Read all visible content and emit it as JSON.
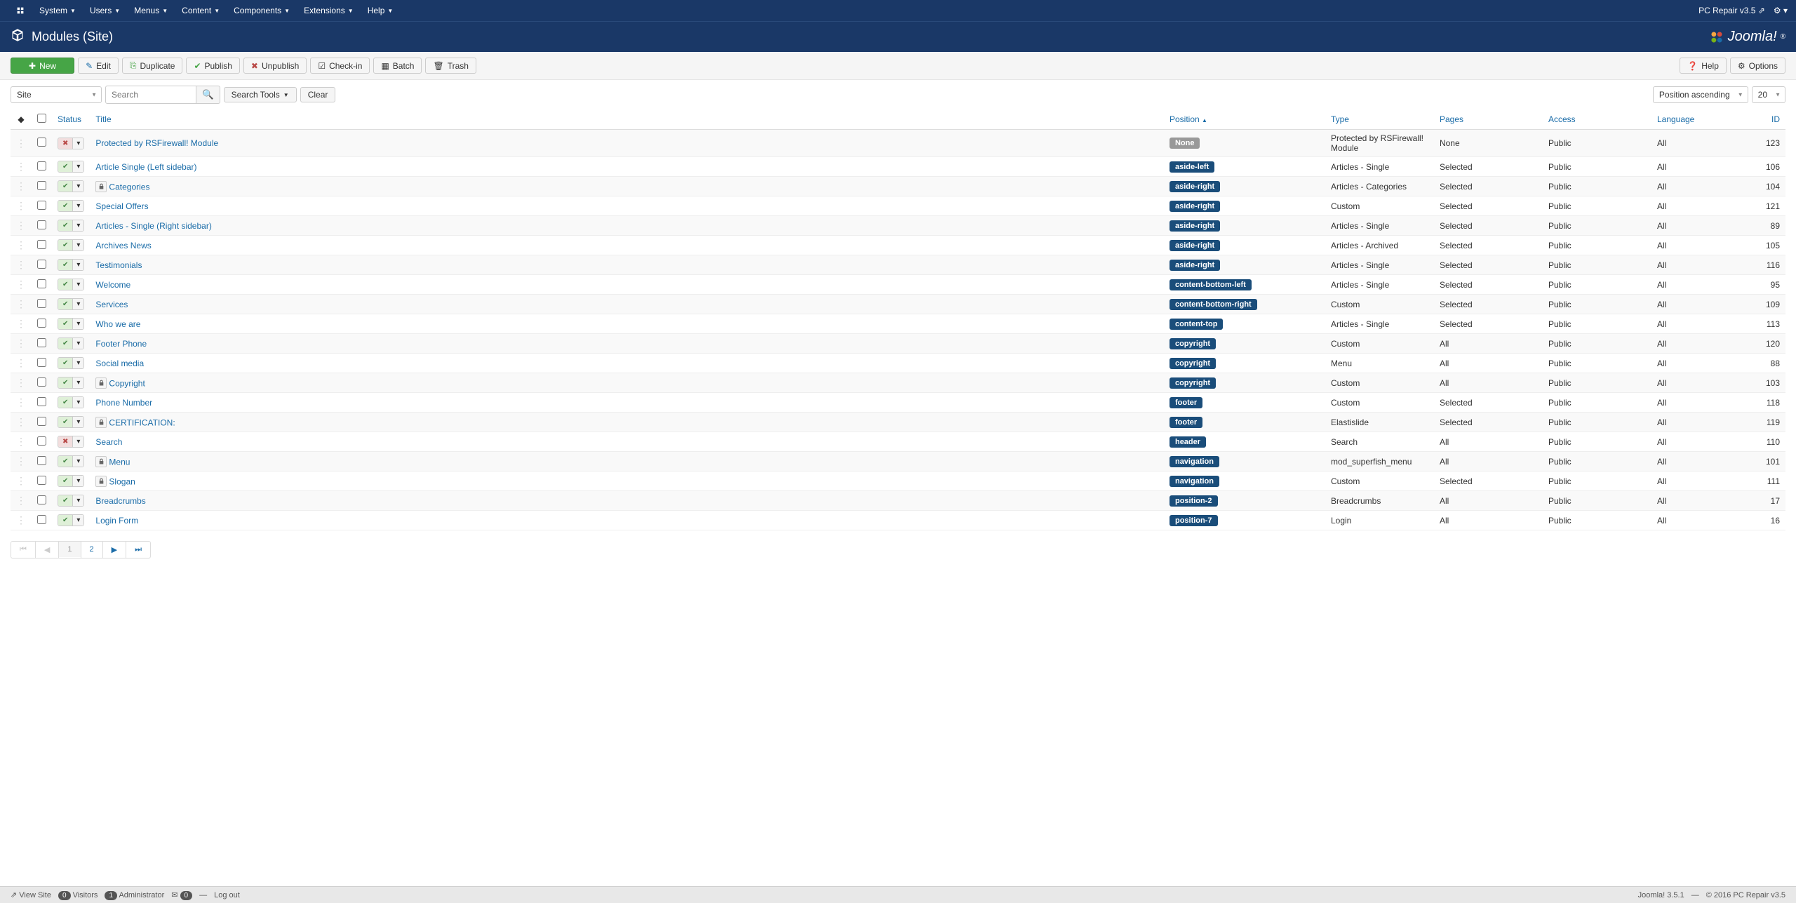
{
  "topnav": {
    "items": [
      "System",
      "Users",
      "Menus",
      "Content",
      "Components",
      "Extensions",
      "Help"
    ],
    "site_name": "PC Repair v3.5"
  },
  "header": {
    "title": "Modules (Site)",
    "brand": "Joomla!"
  },
  "toolbar": {
    "new": "New",
    "edit": "Edit",
    "duplicate": "Duplicate",
    "publish": "Publish",
    "unpublish": "Unpublish",
    "checkin": "Check-in",
    "batch": "Batch",
    "trash": "Trash",
    "help": "Help",
    "options": "Options"
  },
  "filter": {
    "client": "Site",
    "search_placeholder": "Search",
    "search_tools": "Search Tools",
    "clear": "Clear",
    "sort": "Position ascending",
    "limit": "20"
  },
  "columns": {
    "status": "Status",
    "title": "Title",
    "position": "Position",
    "type": "Type",
    "pages": "Pages",
    "access": "Access",
    "language": "Language",
    "id": "ID"
  },
  "rows": [
    {
      "published": false,
      "locked": false,
      "title": "Protected by RSFirewall! Module",
      "position": "None",
      "pos_none": true,
      "type": "Protected by RSFirewall! Module",
      "pages": "None",
      "access": "Public",
      "lang": "All",
      "id": "123"
    },
    {
      "published": true,
      "locked": false,
      "title": "Article Single (Left sidebar)",
      "position": "aside-left",
      "type": "Articles - Single",
      "pages": "Selected",
      "access": "Public",
      "lang": "All",
      "id": "106"
    },
    {
      "published": true,
      "locked": true,
      "title": "Categories",
      "position": "aside-right",
      "type": "Articles - Categories",
      "pages": "Selected",
      "access": "Public",
      "lang": "All",
      "id": "104"
    },
    {
      "published": true,
      "locked": false,
      "title": "Special Offers",
      "position": "aside-right",
      "type": "Custom",
      "pages": "Selected",
      "access": "Public",
      "lang": "All",
      "id": "121"
    },
    {
      "published": true,
      "locked": false,
      "title": "Articles - Single (Right sidebar)",
      "position": "aside-right",
      "type": "Articles - Single",
      "pages": "Selected",
      "access": "Public",
      "lang": "All",
      "id": "89"
    },
    {
      "published": true,
      "locked": false,
      "title": "Archives News",
      "position": "aside-right",
      "type": "Articles - Archived",
      "pages": "Selected",
      "access": "Public",
      "lang": "All",
      "id": "105"
    },
    {
      "published": true,
      "locked": false,
      "title": "Testimonials",
      "position": "aside-right",
      "type": "Articles - Single",
      "pages": "Selected",
      "access": "Public",
      "lang": "All",
      "id": "116"
    },
    {
      "published": true,
      "locked": false,
      "title": "Welcome",
      "position": "content-bottom-left",
      "type": "Articles - Single",
      "pages": "Selected",
      "access": "Public",
      "lang": "All",
      "id": "95"
    },
    {
      "published": true,
      "locked": false,
      "title": "Services",
      "position": "content-bottom-right",
      "type": "Custom",
      "pages": "Selected",
      "access": "Public",
      "lang": "All",
      "id": "109"
    },
    {
      "published": true,
      "locked": false,
      "title": "Who we are",
      "position": "content-top",
      "type": "Articles - Single",
      "pages": "Selected",
      "access": "Public",
      "lang": "All",
      "id": "113"
    },
    {
      "published": true,
      "locked": false,
      "title": "Footer Phone",
      "position": "copyright",
      "type": "Custom",
      "pages": "All",
      "access": "Public",
      "lang": "All",
      "id": "120"
    },
    {
      "published": true,
      "locked": false,
      "title": "Social media",
      "position": "copyright",
      "type": "Menu",
      "pages": "All",
      "access": "Public",
      "lang": "All",
      "id": "88"
    },
    {
      "published": true,
      "locked": true,
      "title": "Copyright",
      "position": "copyright",
      "type": "Custom",
      "pages": "All",
      "access": "Public",
      "lang": "All",
      "id": "103"
    },
    {
      "published": true,
      "locked": false,
      "title": "Phone Number",
      "position": "footer",
      "type": "Custom",
      "pages": "Selected",
      "access": "Public",
      "lang": "All",
      "id": "118"
    },
    {
      "published": true,
      "locked": true,
      "title": "CERTIFICATION:",
      "position": "footer",
      "type": "Elastislide",
      "pages": "Selected",
      "access": "Public",
      "lang": "All",
      "id": "119"
    },
    {
      "published": false,
      "locked": false,
      "title": "Search",
      "position": "header",
      "type": "Search",
      "pages": "All",
      "access": "Public",
      "lang": "All",
      "id": "110"
    },
    {
      "published": true,
      "locked": true,
      "title": "Menu",
      "position": "navigation",
      "type": "mod_superfish_menu",
      "pages": "All",
      "access": "Public",
      "lang": "All",
      "id": "101"
    },
    {
      "published": true,
      "locked": true,
      "title": "Slogan",
      "position": "navigation",
      "type": "Custom",
      "pages": "Selected",
      "access": "Public",
      "lang": "All",
      "id": "111"
    },
    {
      "published": true,
      "locked": false,
      "title": "Breadcrumbs",
      "position": "position-2",
      "type": "Breadcrumbs",
      "pages": "All",
      "access": "Public",
      "lang": "All",
      "id": "17"
    },
    {
      "published": true,
      "locked": false,
      "title": "Login Form",
      "position": "position-7",
      "type": "Login",
      "pages": "All",
      "access": "Public",
      "lang": "All",
      "id": "16"
    }
  ],
  "pagination": {
    "pages": [
      "1",
      "2"
    ],
    "current": "1"
  },
  "footer": {
    "view_site": "View Site",
    "visitors": "Visitors",
    "visitors_count": "0",
    "admin": "Administrator",
    "admin_count": "1",
    "msg_count": "0",
    "logout": "Log out",
    "version": "Joomla! 3.5.1",
    "copyright": "© 2016 PC Repair v3.5"
  }
}
